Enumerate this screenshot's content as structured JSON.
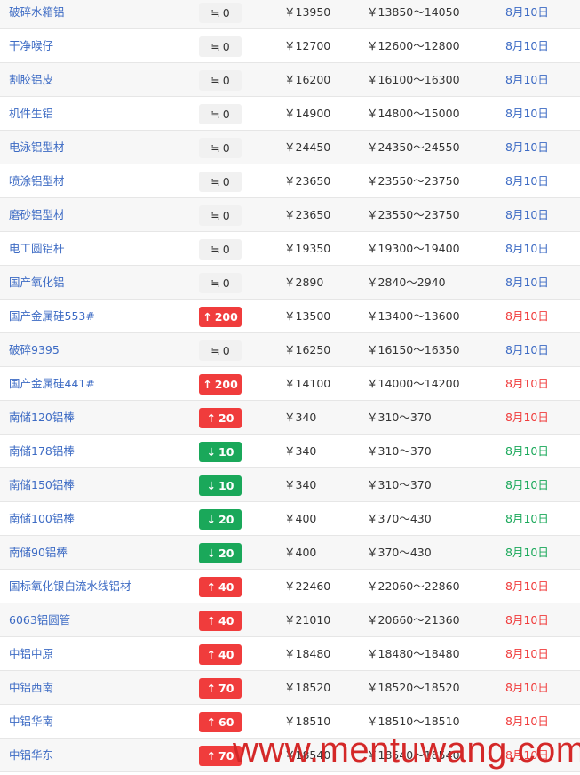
{
  "symbols": {
    "up_arrow": "↑",
    "down_arrow": "↓",
    "flat_symbol": "≒"
  },
  "watermark": {
    "site": "www.mentuwang.com"
  },
  "rows": [
    {
      "name": "破碎水箱铝",
      "direction": "flat",
      "change": "0",
      "price": "￥13950",
      "range": "￥13850～14050",
      "date": "8月10日"
    },
    {
      "name": "干净喉仔",
      "direction": "flat",
      "change": "0",
      "price": "￥12700",
      "range": "￥12600～12800",
      "date": "8月10日"
    },
    {
      "name": "割胶铝皮",
      "direction": "flat",
      "change": "0",
      "price": "￥16200",
      "range": "￥16100～16300",
      "date": "8月10日"
    },
    {
      "name": "机件生铝",
      "direction": "flat",
      "change": "0",
      "price": "￥14900",
      "range": "￥14800～15000",
      "date": "8月10日"
    },
    {
      "name": "电泳铝型材",
      "direction": "flat",
      "change": "0",
      "price": "￥24450",
      "range": "￥24350～24550",
      "date": "8月10日"
    },
    {
      "name": "喷涂铝型材",
      "direction": "flat",
      "change": "0",
      "price": "￥23650",
      "range": "￥23550～23750",
      "date": "8月10日"
    },
    {
      "name": "磨砂铝型材",
      "direction": "flat",
      "change": "0",
      "price": "￥23650",
      "range": "￥23550～23750",
      "date": "8月10日"
    },
    {
      "name": "电工圆铝杆",
      "direction": "flat",
      "change": "0",
      "price": "￥19350",
      "range": "￥19300～19400",
      "date": "8月10日"
    },
    {
      "name": "国产氧化铝",
      "direction": "flat",
      "change": "0",
      "price": "￥2890",
      "range": "￥2840～2940",
      "date": "8月10日"
    },
    {
      "name": "国产金属硅553#",
      "direction": "up",
      "change": "200",
      "price": "￥13500",
      "range": "￥13400～13600",
      "date": "8月10日"
    },
    {
      "name": "破碎9395",
      "direction": "flat",
      "change": "0",
      "price": "￥16250",
      "range": "￥16150～16350",
      "date": "8月10日"
    },
    {
      "name": "国产金属硅441#",
      "direction": "up",
      "change": "200",
      "price": "￥14100",
      "range": "￥14000～14200",
      "date": "8月10日"
    },
    {
      "name": "南储120铝棒",
      "direction": "up",
      "change": "20",
      "price": "￥340",
      "range": "￥310～370",
      "date": "8月10日"
    },
    {
      "name": "南储178铝棒",
      "direction": "down",
      "change": "10",
      "price": "￥340",
      "range": "￥310～370",
      "date": "8月10日"
    },
    {
      "name": "南储150铝棒",
      "direction": "down",
      "change": "10",
      "price": "￥340",
      "range": "￥310～370",
      "date": "8月10日"
    },
    {
      "name": "南储100铝棒",
      "direction": "down",
      "change": "20",
      "price": "￥400",
      "range": "￥370～430",
      "date": "8月10日"
    },
    {
      "name": "南储90铝棒",
      "direction": "down",
      "change": "20",
      "price": "￥400",
      "range": "￥370～430",
      "date": "8月10日"
    },
    {
      "name": "国标氧化银白流水线铝材",
      "direction": "up",
      "change": "40",
      "price": "￥22460",
      "range": "￥22060～22860",
      "date": "8月10日"
    },
    {
      "name": "6063铝圆管",
      "direction": "up",
      "change": "40",
      "price": "￥21010",
      "range": "￥20660～21360",
      "date": "8月10日"
    },
    {
      "name": "中铝中原",
      "direction": "up",
      "change": "40",
      "price": "￥18480",
      "range": "￥18480～18480",
      "date": "8月10日"
    },
    {
      "name": "中铝西南",
      "direction": "up",
      "change": "70",
      "price": "￥18520",
      "range": "￥18520～18520",
      "date": "8月10日"
    },
    {
      "name": "中铝华南",
      "direction": "up",
      "change": "60",
      "price": "￥18510",
      "range": "￥18510～18510",
      "date": "8月10日"
    },
    {
      "name": "中铝华东",
      "direction": "up",
      "change": "70",
      "price": "￥18540",
      "range": "￥18540～18540",
      "date": "8月10日"
    }
  ]
}
